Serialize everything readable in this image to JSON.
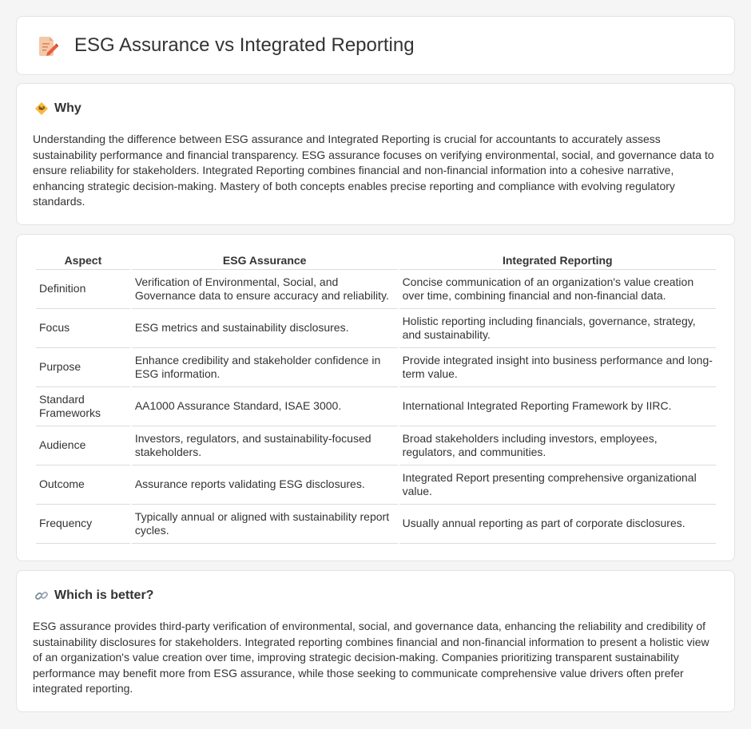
{
  "header": {
    "title": "ESG Assurance vs Integrated Reporting",
    "icon": "document-edit-icon"
  },
  "why": {
    "icon": "handshake-icon",
    "heading": "Why",
    "body": "Understanding the difference between ESG assurance and Integrated Reporting is crucial for accountants to accurately assess sustainability performance and financial transparency. ESG assurance focuses on verifying environmental, social, and governance data to ensure reliability for stakeholders. Integrated Reporting combines financial and non-financial information into a cohesive narrative, enhancing strategic decision-making. Mastery of both concepts enables precise reporting and compliance with evolving regulatory standards."
  },
  "comparison": {
    "headers": [
      "Aspect",
      "ESG Assurance",
      "Integrated Reporting"
    ],
    "rows": [
      [
        "Definition",
        "Verification of Environmental, Social, and Governance data to ensure accuracy and reliability.",
        "Concise communication of an organization's value creation over time, combining financial and non-financial data."
      ],
      [
        "Focus",
        "ESG metrics and sustainability disclosures.",
        "Holistic reporting including financials, governance, strategy, and sustainability."
      ],
      [
        "Purpose",
        "Enhance credibility and stakeholder confidence in ESG information.",
        "Provide integrated insight into business performance and long-term value."
      ],
      [
        "Standard Frameworks",
        "AA1000 Assurance Standard, ISAE 3000.",
        "International Integrated Reporting Framework by IIRC."
      ],
      [
        "Audience",
        "Investors, regulators, and sustainability-focused stakeholders.",
        "Broad stakeholders including investors, employees, regulators, and communities."
      ],
      [
        "Outcome",
        "Assurance reports validating ESG disclosures.",
        "Integrated Report presenting comprehensive organizational value."
      ],
      [
        "Frequency",
        "Typically annual or aligned with sustainability report cycles.",
        "Usually annual reporting as part of corporate disclosures."
      ]
    ]
  },
  "better": {
    "icon": "link-icon",
    "heading": "Which is better?",
    "body": "ESG assurance provides third-party verification of environmental, social, and governance data, enhancing the reliability and credibility of sustainability disclosures for stakeholders. Integrated reporting combines financial and non-financial information to present a holistic view of an organization's value creation over time, improving strategic decision-making. Companies prioritizing transparent sustainability performance may benefit more from ESG assurance, while those seeking to communicate comprehensive value drivers often prefer integrated reporting."
  }
}
